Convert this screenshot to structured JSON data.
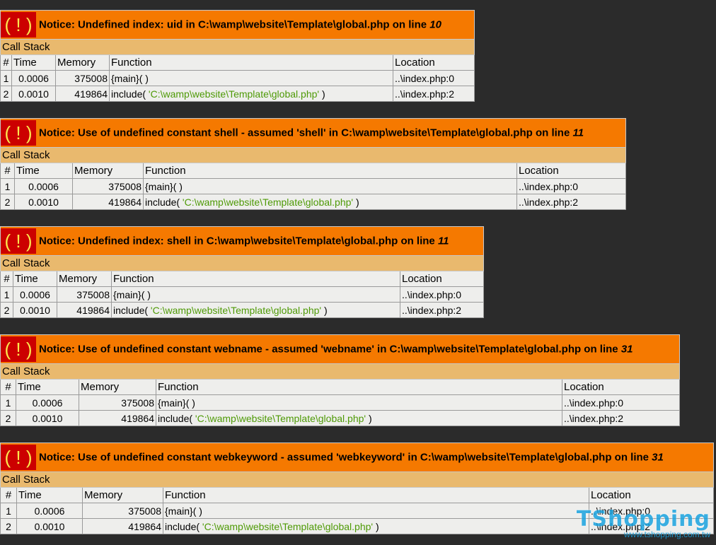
{
  "callstack_label": "Call Stack",
  "icon_glyph": "( ! )",
  "columns": {
    "num": "#",
    "time": "Time",
    "memory": "Memory",
    "function": "Function",
    "location": "Location"
  },
  "colors": {
    "page_background": "#2b2b2b",
    "notice_header": "#f57900",
    "callstack_header": "#e9b96e",
    "icon_background": "#cc0000",
    "icon_foreground": "#fce94f",
    "string_argument": "#4e9a06"
  },
  "errors": [
    {
      "message": "Notice: Undefined index: uid in C:\\wamp\\website\\Template\\global.php on line ",
      "line": "10",
      "rows": [
        {
          "num": "1",
          "time": "0.0006",
          "memory": "375008",
          "function": "{main}( )",
          "func_name": "",
          "func_arg": "",
          "func_close": "",
          "location": "..\\index.php:0"
        },
        {
          "num": "2",
          "time": "0.0010",
          "memory": "419864",
          "function": "",
          "func_name": "include( ",
          "func_arg": "'C:\\wamp\\website\\Template\\global.php'",
          "func_close": " )",
          "location": "..\\index.php:2"
        }
      ]
    },
    {
      "message": "Notice: Use of undefined constant shell - assumed 'shell' in C:\\wamp\\website\\Template\\global.php on line ",
      "line": "11",
      "rows": [
        {
          "num": "1",
          "time": "0.0006",
          "memory": "375008",
          "function": "{main}( )",
          "func_name": "",
          "func_arg": "",
          "func_close": "",
          "location": "..\\index.php:0"
        },
        {
          "num": "2",
          "time": "0.0010",
          "memory": "419864",
          "function": "",
          "func_name": "include( ",
          "func_arg": "'C:\\wamp\\website\\Template\\global.php'",
          "func_close": " )",
          "location": "..\\index.php:2"
        }
      ]
    },
    {
      "message": "Notice: Undefined index: shell in C:\\wamp\\website\\Template\\global.php on line ",
      "line": "11",
      "rows": [
        {
          "num": "1",
          "time": "0.0006",
          "memory": "375008",
          "function": "{main}( )",
          "func_name": "",
          "func_arg": "",
          "func_close": "",
          "location": "..\\index.php:0"
        },
        {
          "num": "2",
          "time": "0.0010",
          "memory": "419864",
          "function": "",
          "func_name": "include( ",
          "func_arg": "'C:\\wamp\\website\\Template\\global.php'",
          "func_close": " )",
          "location": "..\\index.php:2"
        }
      ]
    },
    {
      "message": "Notice: Use of undefined constant webname - assumed 'webname' in C:\\wamp\\website\\Template\\global.php on line ",
      "line": "31",
      "rows": [
        {
          "num": "1",
          "time": "0.0006",
          "memory": "375008",
          "function": "{main}( )",
          "func_name": "",
          "func_arg": "",
          "func_close": "",
          "location": "..\\index.php:0"
        },
        {
          "num": "2",
          "time": "0.0010",
          "memory": "419864",
          "function": "",
          "func_name": "include( ",
          "func_arg": "'C:\\wamp\\website\\Template\\global.php'",
          "func_close": " )",
          "location": "..\\index.php:2"
        }
      ]
    },
    {
      "message": "Notice: Use of undefined constant webkeyword - assumed 'webkeyword' in C:\\wamp\\website\\Template\\global.php on line ",
      "line": "31",
      "rows": [
        {
          "num": "1",
          "time": "0.0006",
          "memory": "375008",
          "function": "{main}( )",
          "func_name": "",
          "func_arg": "",
          "func_close": "",
          "location": "..\\index.php:0"
        },
        {
          "num": "2",
          "time": "0.0010",
          "memory": "419864",
          "function": "",
          "func_name": "include( ",
          "func_arg": "'C:\\wamp\\website\\Template\\global.php'",
          "func_close": " )",
          "location": "..\\index.php:2"
        }
      ]
    }
  ],
  "watermark": {
    "brand": "TShopping",
    "url": "www.tshopping.com.tw"
  }
}
